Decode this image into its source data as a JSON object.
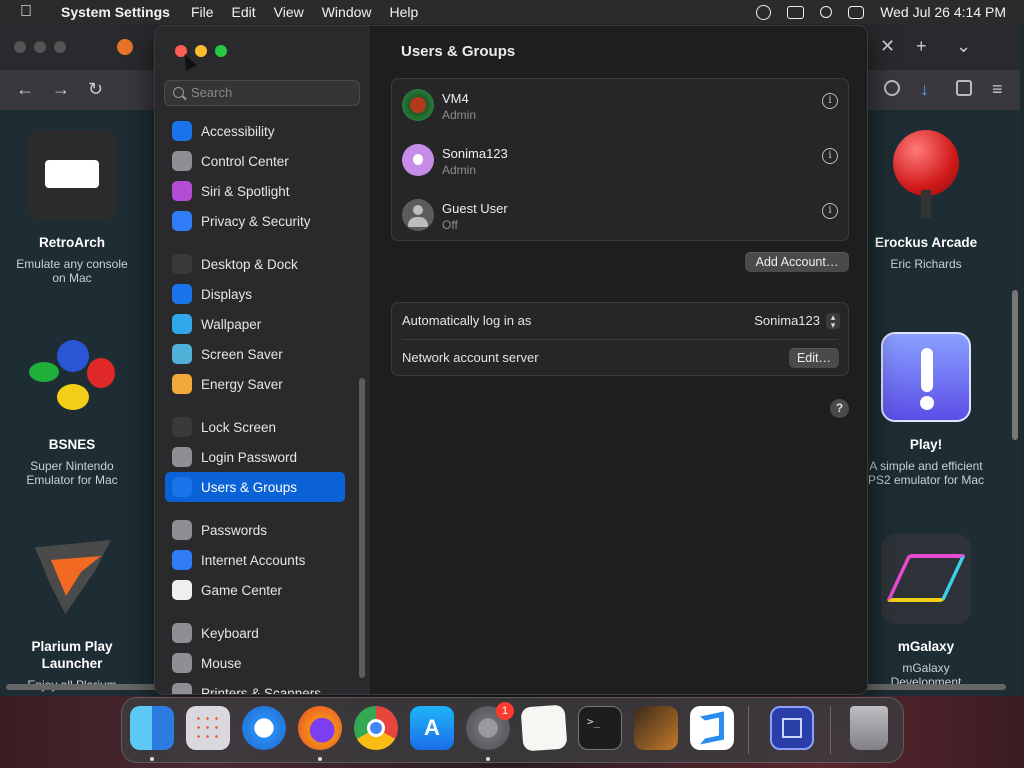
{
  "menubar": {
    "apple_icon": "apple-logo-icon",
    "app_name": "System Settings",
    "items": [
      "File",
      "Edit",
      "View",
      "Window",
      "Help"
    ],
    "datetime": "Wed Jul 26  4:14 PM"
  },
  "browser_bg": {
    "apps": [
      {
        "name": "RetroArch",
        "desc": "Emulate any console on Mac"
      },
      {
        "name": "BSNES",
        "desc": "Super Nintendo Emulator for Mac"
      },
      {
        "name": "Plarium Play Launcher",
        "desc": "Enjoy all Plarium"
      },
      {
        "name": "Erockus Arcade",
        "desc": "Eric Richards"
      },
      {
        "name": "Play!",
        "desc": "A simple and efficient PS2 emulator for Mac"
      },
      {
        "name": "mGalaxy",
        "desc": "mGalaxy Development"
      }
    ]
  },
  "settings": {
    "search_placeholder": "Search",
    "sidebar": [
      {
        "label": "Accessibility",
        "color": "#1a73e8",
        "icon": "accessibility-icon"
      },
      {
        "label": "Control Center",
        "color": "#8e8e93",
        "icon": "control-center-icon"
      },
      {
        "label": "Siri & Spotlight",
        "color": "#b34dd6",
        "icon": "siri-icon"
      },
      {
        "label": "Privacy & Security",
        "color": "#2f7cf6",
        "icon": "hand-icon"
      },
      {
        "label": "Desktop & Dock",
        "color": "#3a3a3c",
        "icon": "desktop-dock-icon"
      },
      {
        "label": "Displays",
        "color": "#1a73e8",
        "icon": "displays-icon"
      },
      {
        "label": "Wallpaper",
        "color": "#30a7e6",
        "icon": "wallpaper-icon"
      },
      {
        "label": "Screen Saver",
        "color": "#4fb0d8",
        "icon": "screen-saver-icon"
      },
      {
        "label": "Energy Saver",
        "color": "#f2a93b",
        "icon": "energy-icon"
      },
      {
        "label": "Lock Screen",
        "color": "#3a3a3c",
        "icon": "lock-icon"
      },
      {
        "label": "Login Password",
        "color": "#8e8e93",
        "icon": "lock-icon"
      },
      {
        "label": "Users & Groups",
        "color": "#1a73e8",
        "icon": "users-icon"
      },
      {
        "label": "Passwords",
        "color": "#8e8e93",
        "icon": "key-icon"
      },
      {
        "label": "Internet Accounts",
        "color": "#2f7cf6",
        "icon": "at-icon"
      },
      {
        "label": "Game Center",
        "color": "#f0f0f0",
        "icon": "game-center-icon"
      },
      {
        "label": "Keyboard",
        "color": "#8e8e93",
        "icon": "keyboard-icon"
      },
      {
        "label": "Mouse",
        "color": "#8e8e93",
        "icon": "mouse-icon"
      },
      {
        "label": "Printers & Scanners",
        "color": "#8e8e93",
        "icon": "printer-icon"
      }
    ],
    "active_item": "Users & Groups",
    "page_title": "Users & Groups",
    "users": [
      {
        "name": "VM4",
        "role": "Admin",
        "avatar_color": "#7a2a1a"
      },
      {
        "name": "Sonima123",
        "role": "Admin",
        "avatar_color": "#c78be8"
      },
      {
        "name": "Guest User",
        "role": "Off",
        "avatar_color": "#6d6d70"
      }
    ],
    "add_account_label": "Add Account…",
    "auto_login_label": "Automatically log in as",
    "auto_login_value": "Sonima123",
    "network_server_label": "Network account server",
    "edit_label": "Edit…",
    "help_label": "?"
  },
  "dock": {
    "apps": [
      "Finder",
      "Launchpad",
      "Safari",
      "Firefox",
      "Chrome",
      "App Store",
      "System Settings",
      "TextEdit",
      "Terminal",
      "GarageBand",
      "VS Code",
      "Screen Sharing",
      "Trash"
    ],
    "settings_badge": "1"
  }
}
